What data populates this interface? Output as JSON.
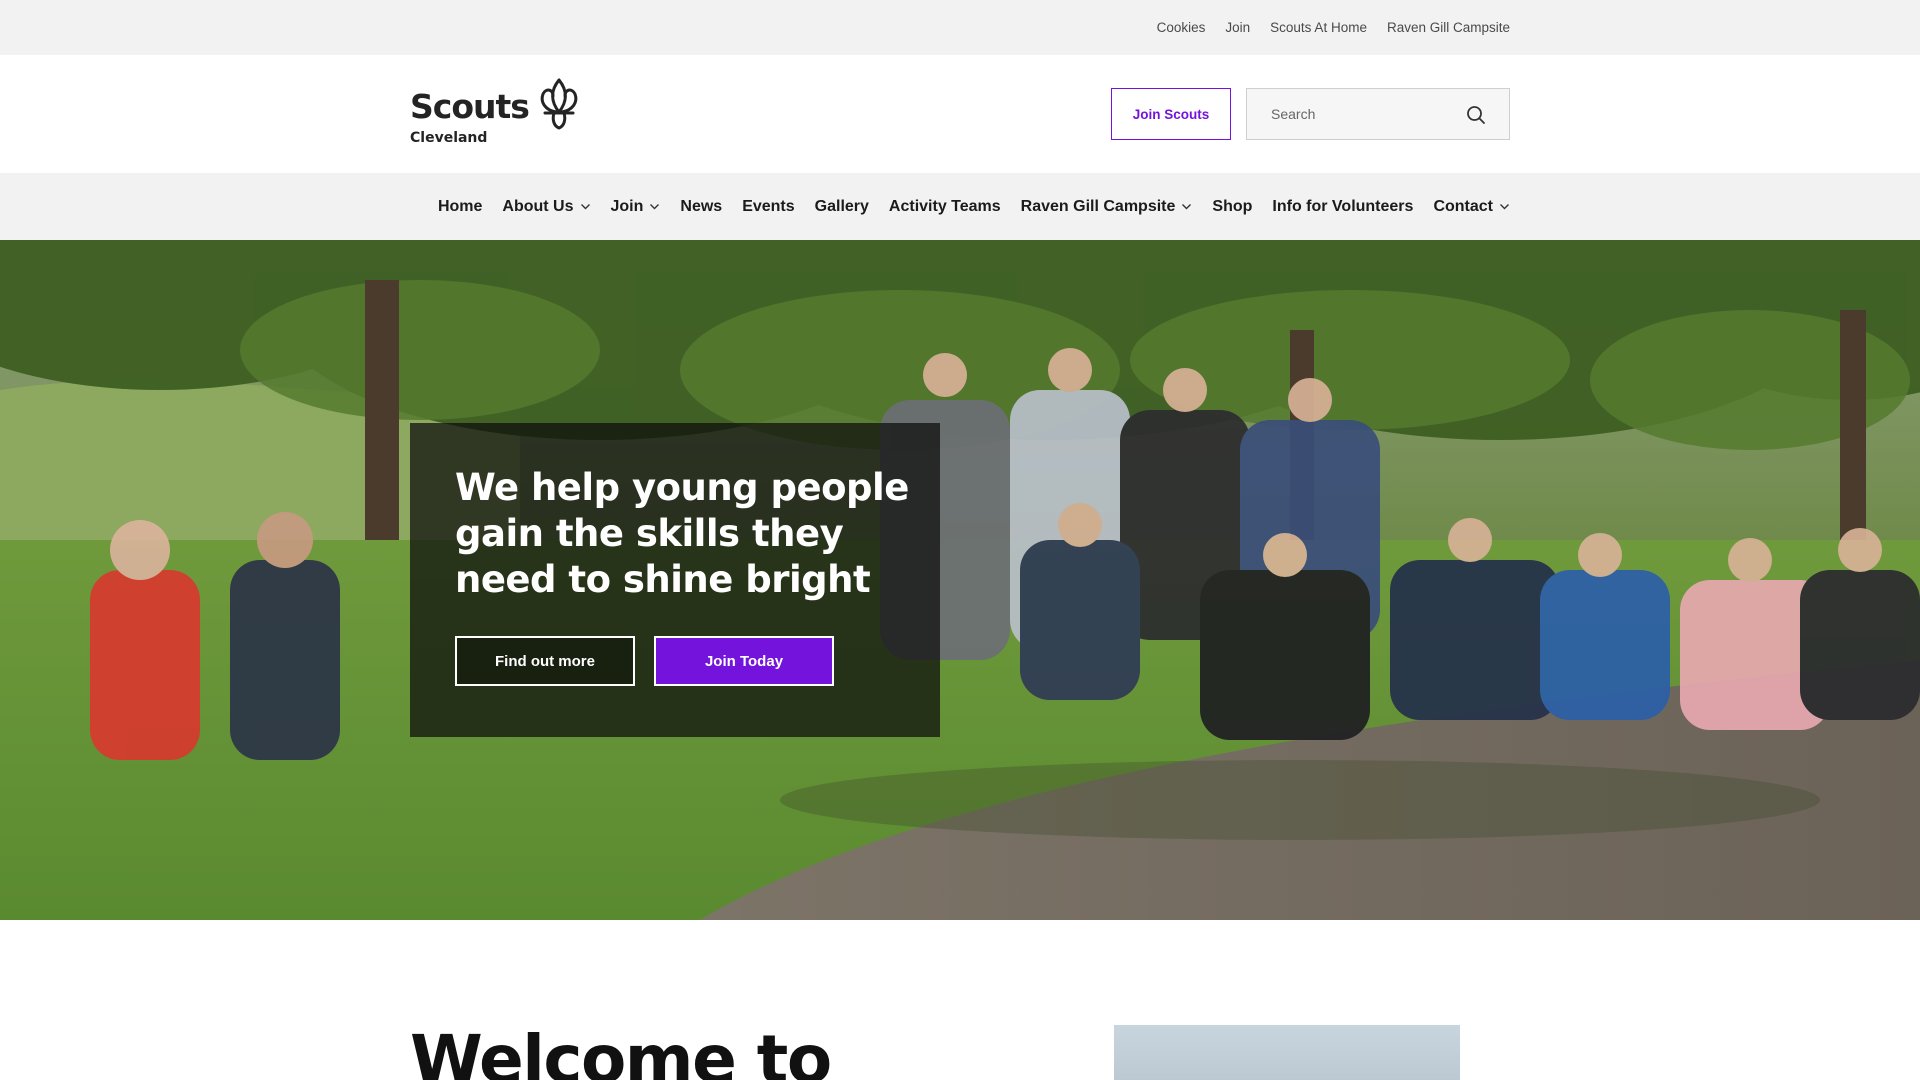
{
  "utility_nav": {
    "items": [
      {
        "label": "Cookies"
      },
      {
        "label": "Join"
      },
      {
        "label": "Scouts At Home"
      },
      {
        "label": "Raven Gill Campsite"
      }
    ]
  },
  "header": {
    "logo": {
      "name": "Scouts",
      "region": "Cleveland",
      "icon": "fleur-de-lis-icon"
    },
    "join_button": "Join Scouts",
    "search": {
      "placeholder": "Search",
      "value": "",
      "icon": "search-icon"
    }
  },
  "main_nav": {
    "items": [
      {
        "label": "Home",
        "dropdown": false
      },
      {
        "label": "About Us",
        "dropdown": true
      },
      {
        "label": "Join",
        "dropdown": true
      },
      {
        "label": "News",
        "dropdown": false
      },
      {
        "label": "Events",
        "dropdown": false
      },
      {
        "label": "Gallery",
        "dropdown": false
      },
      {
        "label": "Activity Teams",
        "dropdown": false
      },
      {
        "label": "Raven Gill Campsite",
        "dropdown": true
      },
      {
        "label": "Shop",
        "dropdown": false
      },
      {
        "label": "Info for Volunteers",
        "dropdown": false
      },
      {
        "label": "Contact",
        "dropdown": true
      }
    ]
  },
  "hero": {
    "title": "We help young people gain the skills they need to shine bright",
    "primary_button": "Find out more",
    "secondary_button": "Join Today"
  },
  "welcome": {
    "heading": "Welcome to"
  },
  "colors": {
    "accent": "#7413dc",
    "bar_bg": "#f2f2f2",
    "text": "#1b1b1b"
  }
}
